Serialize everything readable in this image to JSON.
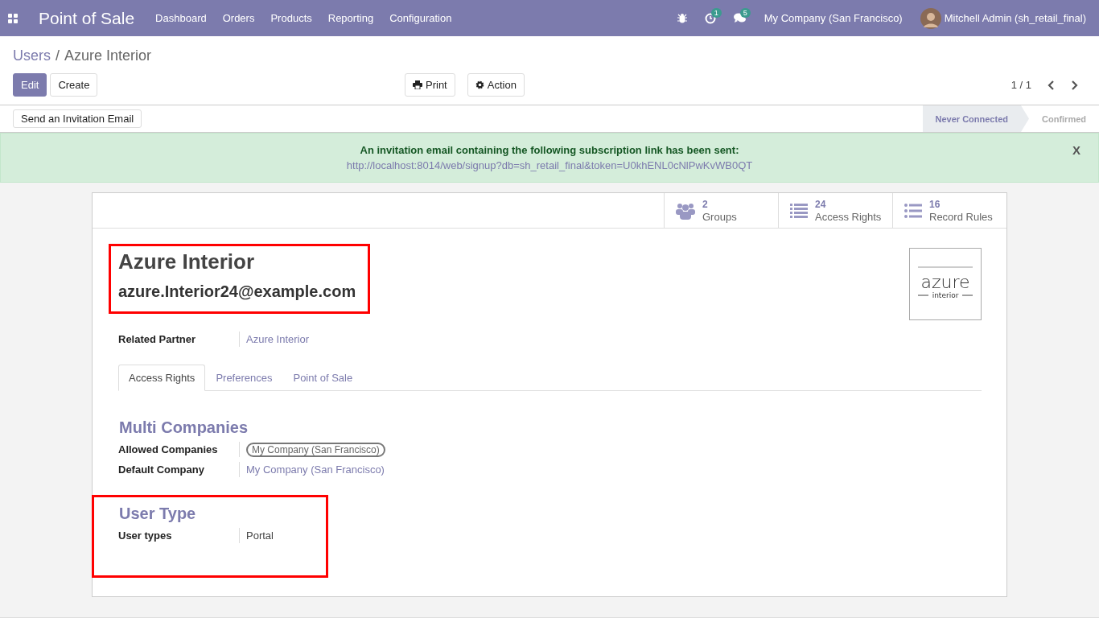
{
  "navbar": {
    "app_title": "Point of Sale",
    "menu": [
      "Dashboard",
      "Orders",
      "Products",
      "Reporting",
      "Configuration"
    ],
    "activity_count": "1",
    "message_count": "5",
    "company": "My Company (San Francisco)",
    "user": "Mitchell Admin (sh_retail_final)"
  },
  "breadcrumb": {
    "parent": "Users",
    "separator": "/",
    "current": "Azure Interior"
  },
  "buttons": {
    "edit": "Edit",
    "create": "Create",
    "print": "Print",
    "action": "Action"
  },
  "pager": "1 / 1",
  "invite_button": "Send an Invitation Email",
  "status_steps": [
    {
      "label": "Never Connected",
      "selected": true
    },
    {
      "label": "Confirmed",
      "selected": false
    }
  ],
  "alert": {
    "message": "An invitation email containing the following subscription link has been sent:",
    "link": "http://localhost:8014/web/signup?db=sh_retail_final&token=U0khENL0cNlPwKvWB0QT",
    "close": "X"
  },
  "smart_buttons": [
    {
      "kind": "groups",
      "count": "2",
      "label": "Groups"
    },
    {
      "kind": "list",
      "count": "24",
      "label": "Access Rights"
    },
    {
      "kind": "bullets",
      "count": "16",
      "label": "Record Rules"
    }
  ],
  "record": {
    "name": "Azure Interior",
    "login": "azure.Interior24@example.com",
    "highlighted": true,
    "logo": {
      "word": "azure",
      "subword": "interior"
    }
  },
  "related_partner": {
    "label": "Related Partner",
    "value": "Azure Interior"
  },
  "tabs": [
    {
      "label": "Access Rights",
      "selected": true
    },
    {
      "label": "Preferences",
      "selected": false
    },
    {
      "label": "Point of Sale",
      "selected": false
    }
  ],
  "multi_companies": {
    "title": "Multi Companies",
    "allowed_label": "Allowed Companies",
    "allowed_tags": [
      "My Company (San Francisco)"
    ],
    "default_label": "Default Company",
    "default_value": "My Company (San Francisco)"
  },
  "user_type": {
    "title": "User Type",
    "label": "User types",
    "value": "Portal",
    "highlighted": true
  }
}
